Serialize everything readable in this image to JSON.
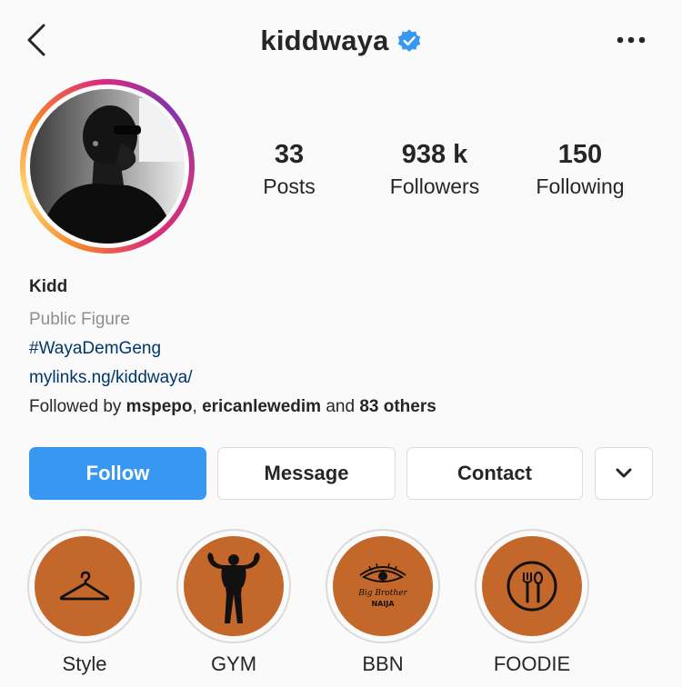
{
  "header": {
    "username": "kiddwaya",
    "verified": true,
    "back_icon": "chevron-left-icon",
    "more_icon": "more-horizontal-icon"
  },
  "stats": [
    {
      "value": "33",
      "label": "Posts"
    },
    {
      "value": "938 k",
      "label": "Followers"
    },
    {
      "value": "150",
      "label": "Following"
    }
  ],
  "bio": {
    "name": "Kidd",
    "category": "Public Figure",
    "hashtag": "#WayaDemGeng",
    "link": "mylinks.ng/kiddwaya/",
    "followed_prefix": "Followed by",
    "followed_user1": "mspepo",
    "followed_sep": ",",
    "followed_user2": "ericanlewedim",
    "followed_and": "and",
    "followed_others": "83 others"
  },
  "actions": {
    "follow": "Follow",
    "message": "Message",
    "contact": "Contact",
    "dropdown_icon": "chevron-down-icon"
  },
  "highlights": [
    {
      "label": "Style",
      "icon": "hanger-icon"
    },
    {
      "label": "GYM",
      "icon": "bodybuilder-icon"
    },
    {
      "label": "BBN",
      "icon": "big-brother-naija-icon",
      "inner_text_1": "Big Brother",
      "inner_text_2": "NAIJA"
    },
    {
      "label": "FOODIE",
      "icon": "plate-cutlery-icon"
    }
  ],
  "colors": {
    "accent": "#3897f0",
    "link": "#00376b",
    "highlight_bg": "#c4672a",
    "verified": "#3897f0"
  }
}
